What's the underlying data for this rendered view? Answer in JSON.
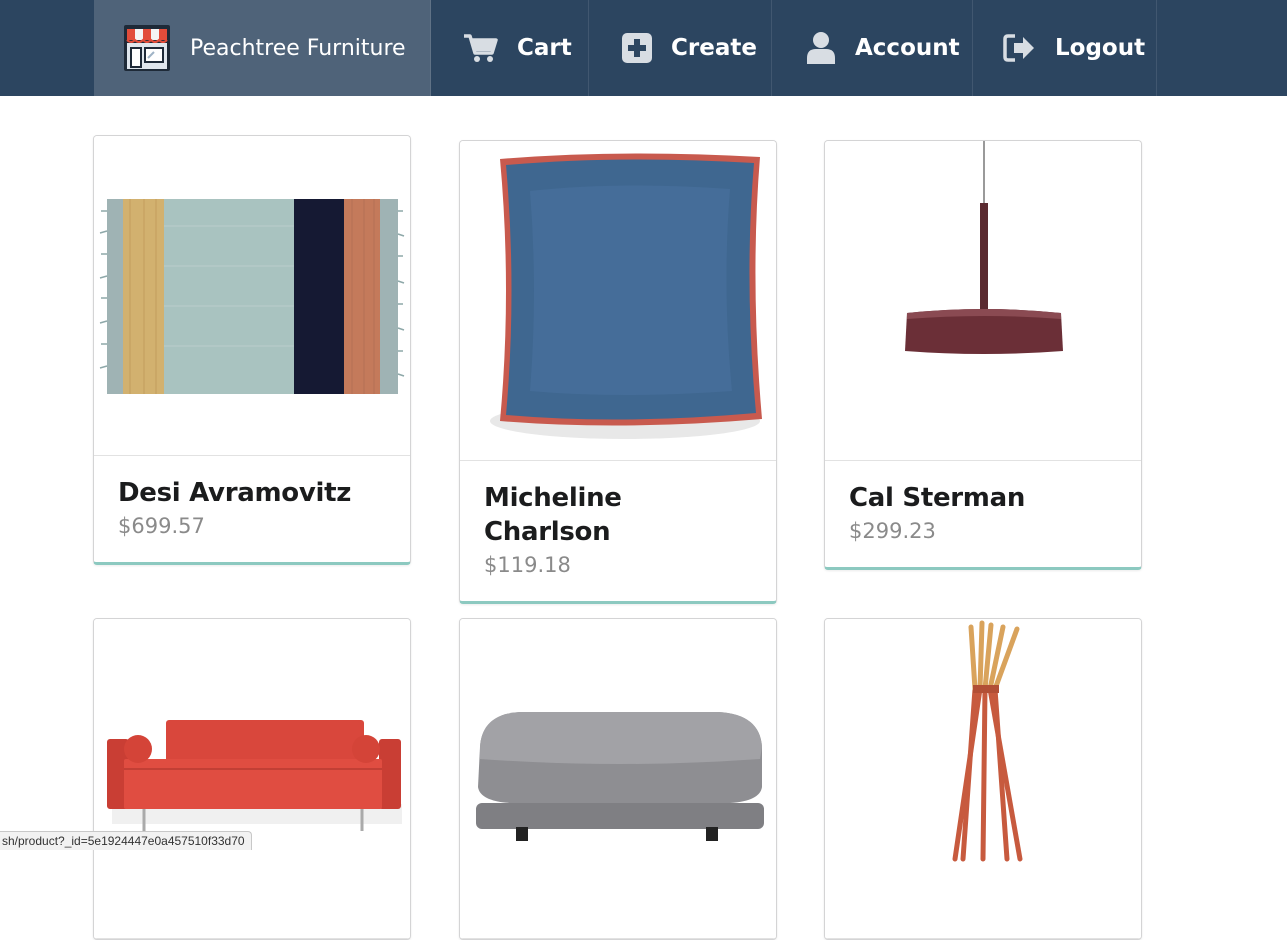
{
  "nav": {
    "brand": "Peachtree Furniture",
    "items": [
      {
        "label": "Cart",
        "icon": "cart-icon"
      },
      {
        "label": "Create",
        "icon": "plus-square-icon"
      },
      {
        "label": "Account",
        "icon": "user-icon"
      },
      {
        "label": "Logout",
        "icon": "sign-out-icon"
      }
    ]
  },
  "products": [
    {
      "name": "Desi Avramovitz",
      "price": "$699.57",
      "image": "striped-rug"
    },
    {
      "name": "Micheline Charlson",
      "price": "$119.18",
      "image": "blue-pillow"
    },
    {
      "name": "Cal Sterman",
      "price": "$299.23",
      "image": "pendant-lamp"
    },
    {
      "name": "",
      "price": "",
      "image": "red-sofa"
    },
    {
      "name": "",
      "price": "",
      "image": "grey-ottoman"
    },
    {
      "name": "",
      "price": "",
      "image": "coat-rack"
    }
  ],
  "statusbar": {
    "url": "sh/product?_id=5e1924447e0a457510f33d70"
  },
  "colors": {
    "navbar": "#2c4560",
    "brand_bg": "#4f6379",
    "card_accent": "#8cc9c0",
    "price_text": "#8a8a8a"
  }
}
